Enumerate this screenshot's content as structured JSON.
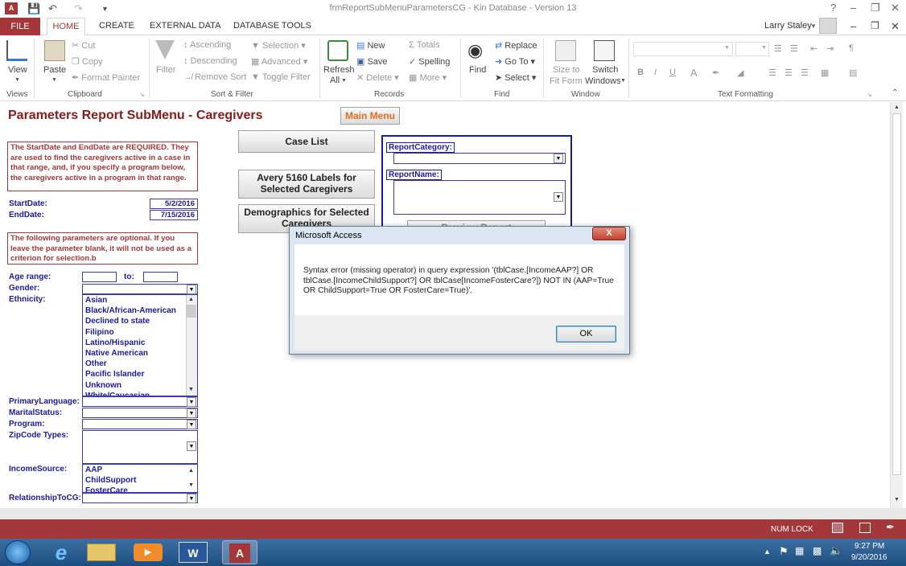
{
  "app": {
    "window_title": "frmReportSubMenuParametersCG - Kin Database - Version 13",
    "user": "Larry Staley",
    "help": "?"
  },
  "tabs": [
    "FILE",
    "HOME",
    "CREATE",
    "EXTERNAL DATA",
    "DATABASE TOOLS"
  ],
  "ribbon": {
    "views": {
      "view": "View",
      "group": "Views"
    },
    "clipboard": {
      "paste": "Paste",
      "cut": "Cut",
      "copy": "Copy",
      "format_painter": "Format Painter",
      "group": "Clipboard"
    },
    "sort_filter": {
      "filter": "Filter",
      "ascending": "Ascending",
      "descending": "Descending",
      "remove_sort": "Remove Sort",
      "selection": "Selection",
      "advanced": "Advanced",
      "toggle_filter": "Toggle Filter",
      "group": "Sort & Filter"
    },
    "records": {
      "refresh": "Refresh",
      "all": "All",
      "new": "New",
      "save": "Save",
      "delete": "Delete",
      "totals": "Totals",
      "spelling": "Spelling",
      "more": "More",
      "group": "Records"
    },
    "find": {
      "find": "Find",
      "replace": "Replace",
      "goto": "Go To",
      "select": "Select",
      "group": "Find"
    },
    "window": {
      "size_to": "Size to",
      "fit_form": "Fit Form",
      "switch": "Switch",
      "windows": "Windows",
      "group": "Window"
    },
    "text_formatting": {
      "bold": "B",
      "italic": "I",
      "underline": "U",
      "font_color": "A",
      "group": "Text Formatting"
    }
  },
  "form": {
    "title": "Parameters Report SubMenu - Caregivers",
    "main_menu_button": "Main Menu",
    "required_note": "The StartDate and EndDate are REQUIRED.  They are used to find the caregivers active in a case in that range, and, if you specify a program below, the caregivers active in a program in that range.",
    "start_date_label": "StartDate:",
    "start_date_value": "5/2/2016",
    "end_date_label": "EndDate:",
    "end_date_value": "7/15/2016",
    "optional_note": "The following parameters are optional.  If you leave the parameter blank, it will not be used as a criterion for selection.b",
    "age_range_label": "Age range:",
    "age_to_label": "to:",
    "gender_label": "Gender:",
    "ethnicity_label": "Ethnicity:",
    "ethnicity_items": [
      "Asian",
      "Black/African-American",
      "Declined to state",
      "Filipino",
      "Latino/Hispanic",
      "Native American",
      "Other",
      "Pacific Islander",
      "Unknown",
      "White/Caucasian"
    ],
    "primary_language_label": "PrimaryLanguage:",
    "marital_status_label": "MaritalStatus:",
    "program_label": "Program:",
    "zipcode_types_label": "ZipCode Types:",
    "income_source_label": "IncomeSource:",
    "income_items": [
      "AAP",
      "ChildSupport",
      "FosterCare"
    ],
    "relationship_label": "RelationshipToCG:",
    "case_list_button": "Case List",
    "avery_button": "Avery 5160 Labels for Selected Caregivers",
    "demographics_button": "Demographics  for Selected Caregivers",
    "report_category_label": "ReportCategory:",
    "report_name_label": "ReportName:",
    "preview_report_button": "Preview Report"
  },
  "dialog": {
    "title": "Microsoft Access",
    "message": "Syntax error (missing operator) in query expression '(tblCase.[IncomeAAP?] OR tblCase.[IncomeChildSupport?] OR tblCase[IncomeFosterCare?]) NOT IN (AAP=True OR ChildSupport=True OR FosterCare=True)'.",
    "ok": "OK",
    "close": "X"
  },
  "status": {
    "num_lock": "NUM LOCK"
  },
  "taskbar": {
    "time": "9:27 PM",
    "date": "9/20/2016"
  },
  "colors": {
    "access_red": "#a4373a",
    "field_navy": "#1a1a9c",
    "taskbar_blue": "#2a5c92"
  }
}
